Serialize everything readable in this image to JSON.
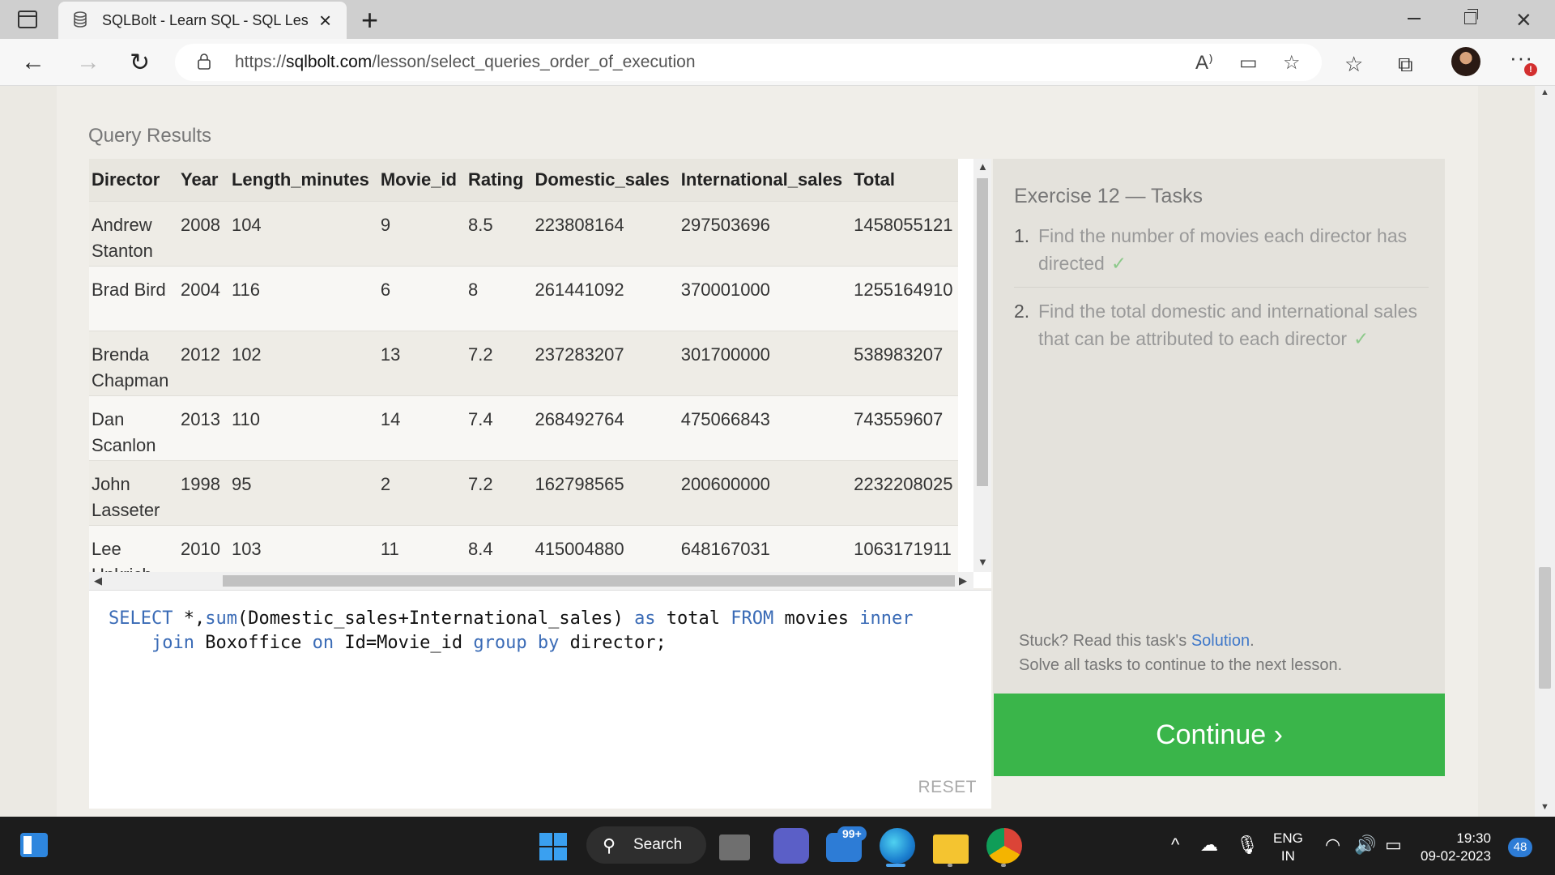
{
  "browser": {
    "tab_title": "SQLBolt - Learn SQL - SQL Lesso",
    "url_prefix": "https://",
    "url_host": "sqlbolt.com",
    "url_path": "/lesson/select_queries_order_of_execution"
  },
  "results": {
    "heading": "Query Results",
    "columns": [
      "Director",
      "Year",
      "Length_minutes",
      "Movie_id",
      "Rating",
      "Domestic_sales",
      "International_sales",
      "Total"
    ],
    "rows": [
      [
        "Andrew Stanton",
        "2008",
        "104",
        "9",
        "8.5",
        "223808164",
        "297503696",
        "1458055121"
      ],
      [
        "Brad Bird",
        "2004",
        "116",
        "6",
        "8",
        "261441092",
        "370001000",
        "1255164910"
      ],
      [
        "Brenda Chapman",
        "2012",
        "102",
        "13",
        "7.2",
        "237283207",
        "301700000",
        "538983207"
      ],
      [
        "Dan Scanlon",
        "2013",
        "110",
        "14",
        "7.4",
        "268492764",
        "475066843",
        "743559607"
      ],
      [
        "John Lasseter",
        "1998",
        "95",
        "2",
        "7.2",
        "162798565",
        "200600000",
        "2232208025"
      ],
      [
        "Lee Unkrich",
        "2010",
        "103",
        "11",
        "8.4",
        "415004880",
        "648167031",
        "1063171911"
      ]
    ]
  },
  "editor": {
    "reset_label": "RESET"
  },
  "tasks": {
    "title": "Exercise 12 — Tasks",
    "items": [
      {
        "num": "1.",
        "text": "Find the number of movies each director has directed",
        "check": "✓"
      },
      {
        "num": "2.",
        "text": "Find the total domestic and international sales that can be attributed to each director",
        "check": "✓"
      }
    ],
    "stuck_prefix": "Stuck? Read this task's ",
    "solution_link": "Solution",
    "stuck_suffix": ".",
    "solve_all": "Solve all tasks to continue to the next lesson."
  },
  "continue_label": "Continue ›",
  "taskbar": {
    "search_label": "Search",
    "mail_badge": "99+",
    "lang_line1": "ENG",
    "lang_line2": "IN",
    "time": "19:30",
    "date": "09-02-2023",
    "notifications": "48"
  }
}
